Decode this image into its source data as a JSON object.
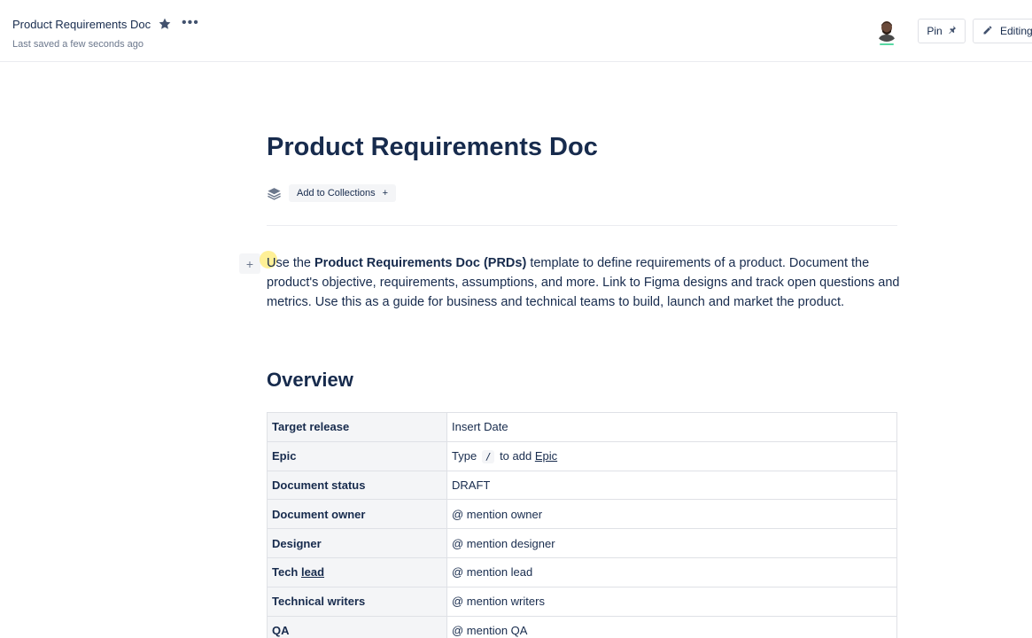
{
  "header": {
    "doc_name": "Product Requirements Doc",
    "saved_status": "Last saved a few seconds ago",
    "more_label": "•••",
    "pin_label": "Pin",
    "edit_label": "Editing"
  },
  "page": {
    "title": "Product Requirements Doc",
    "add_collections_label": "Add to Collections",
    "add_plus": "+",
    "drag_plus": "+"
  },
  "intro": {
    "part1": "Use the ",
    "bold": "Product Requirements Doc (PRDs)",
    "part2": " template to define requirements of a product. Document the product's objective, requirements, assumptions, and more. Link to Figma designs and track open questions and metrics. Use this as a guide for business and technical teams to build, launch and market the product."
  },
  "overview": {
    "heading": "Overview",
    "rows": [
      {
        "label": "Target release",
        "value": "Insert Date"
      },
      {
        "label": "Epic",
        "value_prefix": "Type",
        "value_code": "/",
        "value_mid": "to add",
        "value_link": "Epic"
      },
      {
        "label": "Document status",
        "value": "DRAFT"
      },
      {
        "label": "Document owner",
        "value": "@ mention owner"
      },
      {
        "label": "Designer",
        "value": "@ mention designer"
      },
      {
        "label_prefix": "Tech",
        "label_link": "lead",
        "value": "@ mention lead"
      },
      {
        "label": "Technical writers",
        "value": "@ mention writers"
      },
      {
        "label": "QA",
        "value": "@ mention QA"
      }
    ]
  },
  "colors": {
    "text": "#172b4d",
    "muted": "#6b778c",
    "border": "#dfe1e6",
    "label_bg": "#f4f5f7",
    "presence": "#57d9a3"
  },
  "icons": {
    "star": "star-icon",
    "more": "more-icon",
    "pin": "pin-icon",
    "edit": "pencil-icon",
    "collections": "layers-icon",
    "add": "plus-icon"
  }
}
